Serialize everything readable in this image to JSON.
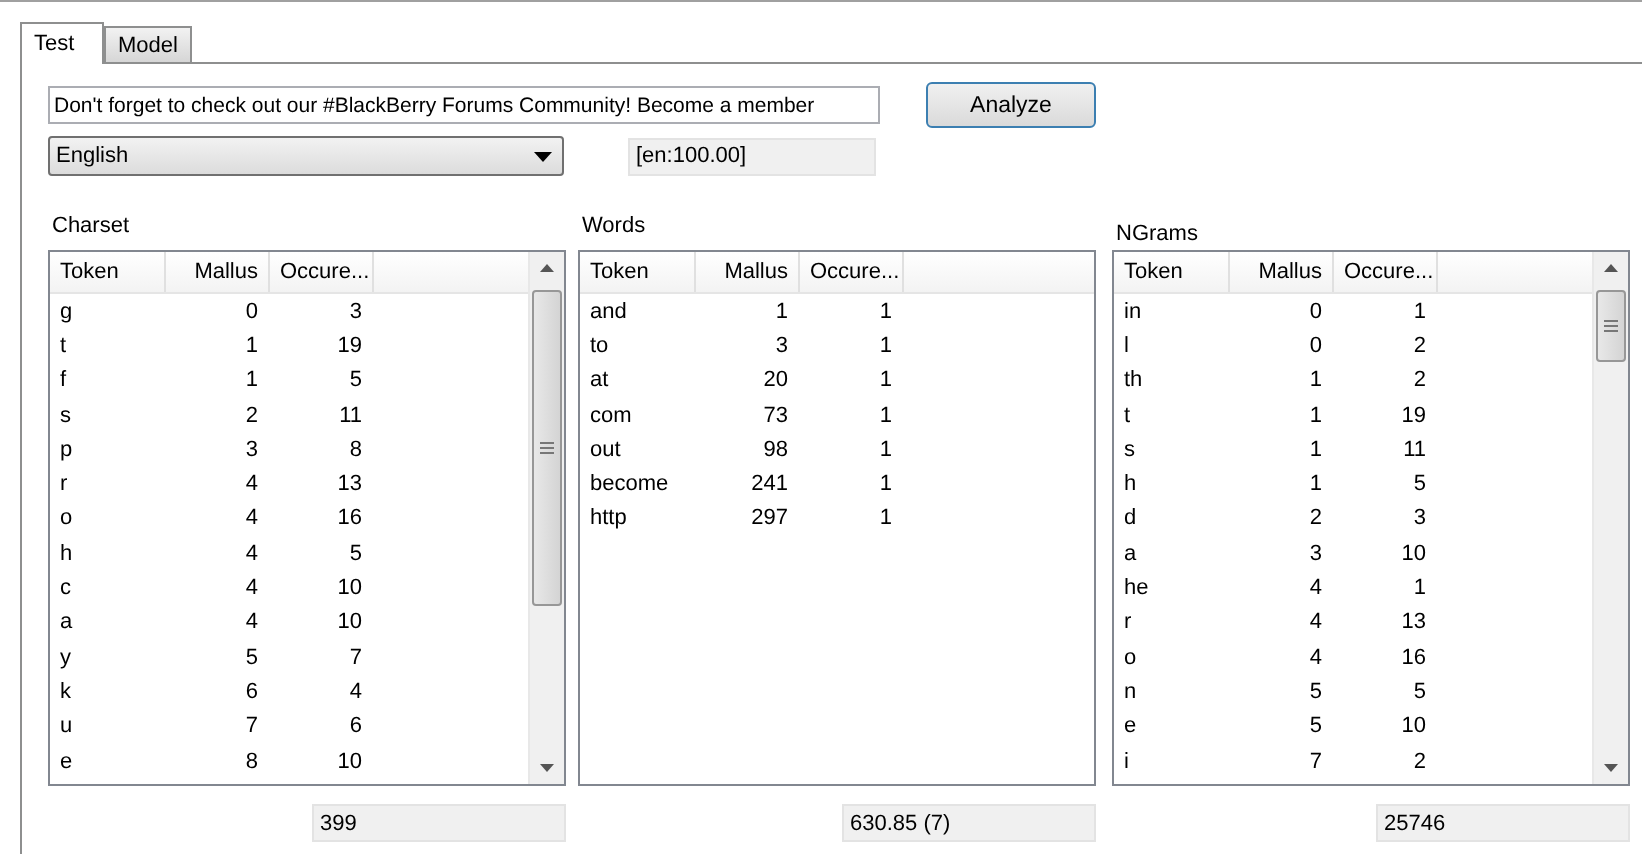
{
  "tabs": [
    {
      "label": "Test",
      "selected": true
    },
    {
      "label": "Model",
      "selected": false
    }
  ],
  "input": {
    "value": "Don't forget to check out our #BlackBerry Forums Community! Become a member"
  },
  "analyze_button": "Analyze",
  "language_select": {
    "value": "English"
  },
  "result": "[en:100.00]",
  "panels": [
    {
      "title": "Charset",
      "columns": [
        "Token",
        "Mallus",
        "Occure..."
      ],
      "scrollbar": true,
      "rows": [
        [
          "g",
          "0",
          "3"
        ],
        [
          "t",
          "1",
          "19"
        ],
        [
          "f",
          "1",
          "5"
        ],
        [
          "s",
          "2",
          "11"
        ],
        [
          "p",
          "3",
          "8"
        ],
        [
          "r",
          "4",
          "13"
        ],
        [
          "o",
          "4",
          "16"
        ],
        [
          "h",
          "4",
          "5"
        ],
        [
          "c",
          "4",
          "10"
        ],
        [
          "a",
          "4",
          "10"
        ],
        [
          "y",
          "5",
          "7"
        ],
        [
          "k",
          "6",
          "4"
        ],
        [
          "u",
          "7",
          "6"
        ],
        [
          "e",
          "8",
          "10"
        ]
      ],
      "total": "399"
    },
    {
      "title": "Words",
      "columns": [
        "Token",
        "Mallus",
        "Occure..."
      ],
      "scrollbar": false,
      "rows": [
        [
          "and",
          "1",
          "1"
        ],
        [
          "to",
          "3",
          "1"
        ],
        [
          "at",
          "20",
          "1"
        ],
        [
          "com",
          "73",
          "1"
        ],
        [
          "out",
          "98",
          "1"
        ],
        [
          "become",
          "241",
          "1"
        ],
        [
          "http",
          "297",
          "1"
        ]
      ],
      "total": "630.85 (7)"
    },
    {
      "title": "NGrams",
      "columns": [
        "Token",
        "Mallus",
        "Occure..."
      ],
      "scrollbar": true,
      "rows": [
        [
          "in",
          "0",
          "1"
        ],
        [
          "l",
          "0",
          "2"
        ],
        [
          "th",
          "1",
          "2"
        ],
        [
          "t",
          "1",
          "19"
        ],
        [
          "s",
          "1",
          "11"
        ],
        [
          "h",
          "1",
          "5"
        ],
        [
          "d",
          "2",
          "3"
        ],
        [
          "a",
          "3",
          "10"
        ],
        [
          "he",
          "4",
          "1"
        ],
        [
          "r",
          "4",
          "13"
        ],
        [
          "o",
          "4",
          "16"
        ],
        [
          "n",
          "5",
          "5"
        ],
        [
          "e",
          "5",
          "10"
        ],
        [
          "i",
          "7",
          "2"
        ]
      ],
      "total": "25746"
    }
  ]
}
